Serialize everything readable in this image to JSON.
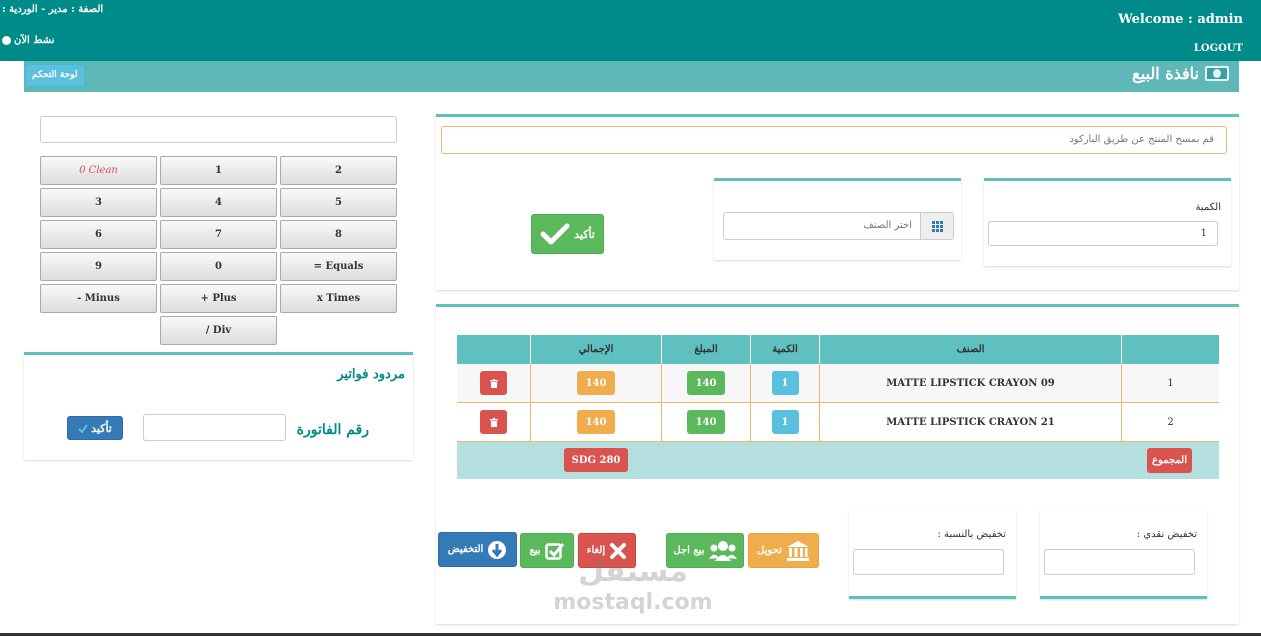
{
  "header": {
    "role": "الصفة : مدير - الوردية :",
    "online": "نشط الآن",
    "welcome": "Welcome : admin",
    "logout": "LOGOUT"
  },
  "titlebar": {
    "control_panel": "لوحة التحكم",
    "title": "نافذة البيع"
  },
  "calculator": {
    "display_value": "",
    "keys": [
      {
        "label": "0 Clean",
        "type": "clean"
      },
      {
        "label": "1"
      },
      {
        "label": "2"
      },
      {
        "label": "3"
      },
      {
        "label": "4"
      },
      {
        "label": "5"
      },
      {
        "label": "6"
      },
      {
        "label": "7"
      },
      {
        "label": "8"
      },
      {
        "label": "9"
      },
      {
        "label": "0"
      },
      {
        "label": "= Equals"
      },
      {
        "label": "- Minus"
      },
      {
        "label": "+ Plus"
      },
      {
        "label": "x Times"
      },
      {
        "label": "/ Div"
      }
    ]
  },
  "returns": {
    "heading": "مردود فواتير",
    "invoice_label": "رقم الفاتورة",
    "invoice_value": "",
    "confirm": "تأكيد"
  },
  "entry": {
    "barcode_placeholder": "قم بمسح المنتج عن طريق الباركود",
    "quantity_label": "الكمية",
    "quantity_value": "1",
    "item_placeholder": "اختر الصنف",
    "confirm": "تأكيد"
  },
  "table": {
    "headers": [
      "",
      "الصنف",
      "الكمية",
      "المبلغ",
      "الإجمالي",
      ""
    ],
    "rows": [
      {
        "index": "1",
        "item": "MATTE LIPSTICK CRAYON 09",
        "qty": "1",
        "amount": "140",
        "total": "140"
      },
      {
        "index": "2",
        "item": "MATTE LIPSTICK CRAYON 21",
        "qty": "1",
        "amount": "140",
        "total": "140"
      }
    ],
    "sum_label": "المجموع",
    "grand_total": "SDG 280"
  },
  "discounts": {
    "cash_label": "تخفيض نقدي :",
    "percent_label": "تخفيض بالنسبة :",
    "cash_value": "",
    "percent_value": ""
  },
  "actions": {
    "transfer": "تحويل",
    "credit_sale": "بيع اجل",
    "cancel": "إلغاء",
    "sell": "بيع",
    "discount": "التخفيض"
  },
  "watermark": {
    "arabic": "مستقل",
    "latin": "mostaql.com"
  },
  "colors": {
    "header": "#008b8b",
    "accent": "#5fc0c0",
    "success": "#5cb85c",
    "danger": "#d9534f",
    "warning": "#f0ad4e",
    "info": "#5bc0de",
    "primary": "#337ab7"
  }
}
